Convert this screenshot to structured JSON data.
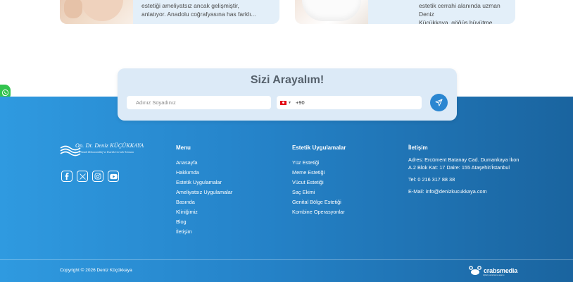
{
  "cards": [
    {
      "excerpt_line1": "estetiği ameliyatsız ancak gelişmiştir,",
      "excerpt_line2": "anlatıyor. Anadolu coğrafyasına has farklı..."
    },
    {
      "excerpt_line1": "estetik cerrahi alanında uzman Deniz",
      "excerpt_line2": "Küçükkaya, göğüs büyütme hakkında..."
    }
  ],
  "callback": {
    "title": "Sizi Arayalım!",
    "name_placeholder": "Adınız Soyadınız",
    "phone_prefix": "+90"
  },
  "logo": {
    "name": "Op. Dr. Deniz KÜÇÜKKAYA",
    "tagline": "Plastik Rekonstrüktif ve Estetik Cerrahi Uzmanı"
  },
  "social_icons": [
    "facebook-icon",
    "x-icon",
    "instagram-icon",
    "youtube-icon"
  ],
  "menu": {
    "title": "Menu",
    "items": [
      "Anasayfa",
      "Hakkımda",
      "Estetik Uygulamalar",
      "Ameliyatsız Uygulamalar",
      "Basında",
      "Kliniğimiz",
      "Blog",
      "İletişim"
    ]
  },
  "aesthetic": {
    "title": "Estetik Uygulamalar",
    "items": [
      "Yüz Estetiği",
      "Meme Estetiği",
      "Vücut Estetiği",
      "Saç Ekimi",
      "Genital Bölge Estetiği",
      "Kombine Operasyonlar"
    ]
  },
  "contact": {
    "title": "İletişim",
    "address": "Adres: Ercüment Batanay Cad. Dumankaya İkon A.2 Blok Kat: 17 Daire: 155 Ataşehir/İstanbul",
    "phone": "Tel: 0 216 317 88 38",
    "email": "E-Mail: info@denizkucukkaya.com"
  },
  "copyright": "Copyright © 2026 Deniz Küçükkaya",
  "agency": {
    "name": "crabsmedia",
    "sub": "dijital pazarlama ajansı"
  },
  "colors": {
    "footer_start": "#2f9ae0",
    "footer_end": "#1a649f",
    "send": "#2a86d1",
    "whatsapp": "#33c44f"
  }
}
